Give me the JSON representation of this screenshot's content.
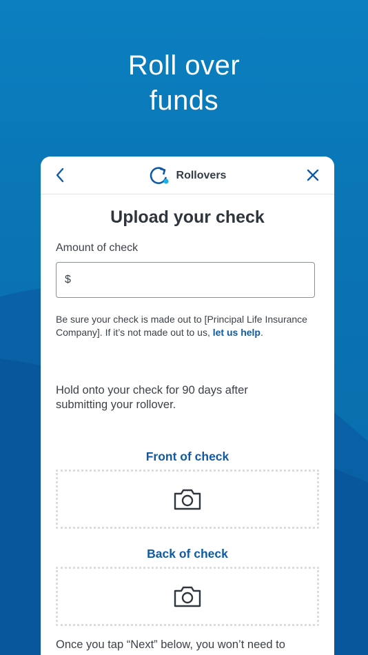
{
  "headline": {
    "line1": "Roll over",
    "line2": "funds"
  },
  "nav": {
    "title": "Rollovers",
    "back_icon": "chevron-left-icon",
    "close_icon": "close-icon",
    "logo_icon": "rollover-refresh-icon"
  },
  "page": {
    "title": "Upload your check",
    "amount_label": "Amount of check",
    "amount_prefix": "$",
    "amount_value": "",
    "note_text": "Be sure your check is made out to [Principal Life Insurance Company]. If it’s not made out to us, ",
    "note_link": "let us help",
    "note_end": ".",
    "hold_text": "Hold onto your check for 90 days after submitting your rollover.",
    "front_label": "Front of check",
    "back_label": "Back of check",
    "camera_icon": "camera-icon",
    "footer_text": "Once you tap “Next” below, you won’t need to"
  },
  "colors": {
    "background": "#0a78b8",
    "accent": "#0f5aa3",
    "logo_dot": "#19b3e6"
  }
}
